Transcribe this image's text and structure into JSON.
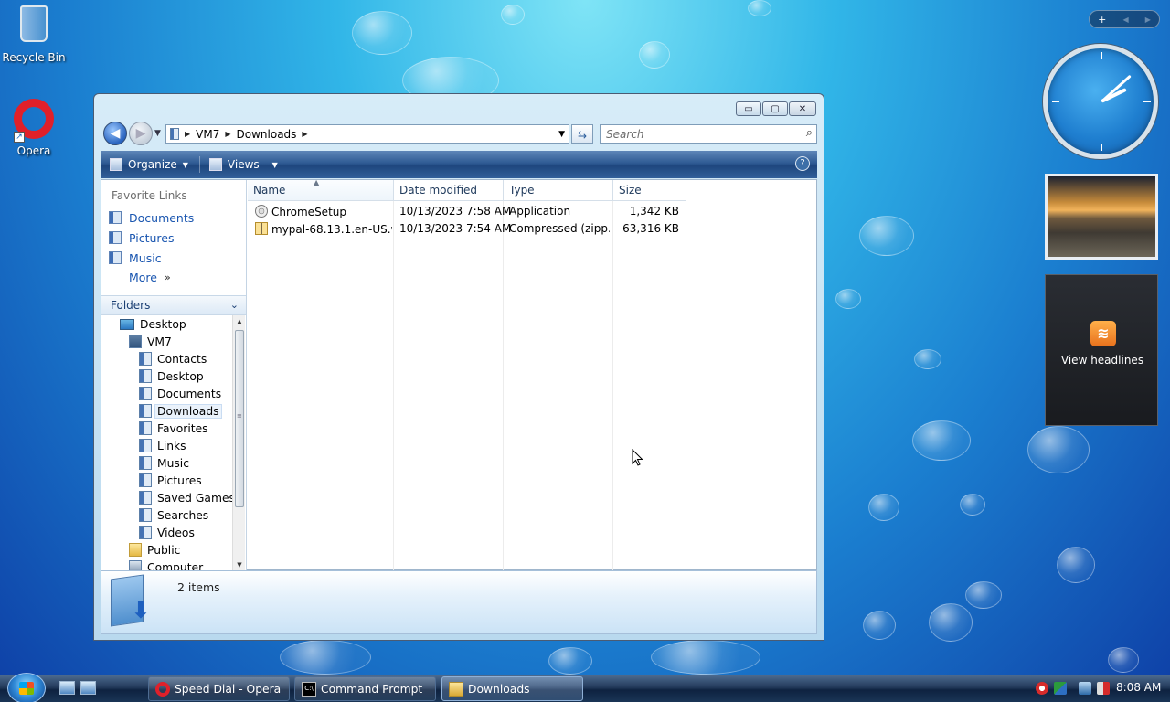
{
  "desktop": {
    "icons": [
      {
        "label": "Recycle Bin",
        "icon": "recycle-bin-icon"
      },
      {
        "label": "Opera",
        "icon": "opera-icon"
      }
    ]
  },
  "window": {
    "title_buttons": {
      "minimize": "▭",
      "maximize": "▢",
      "close": "✕"
    },
    "address": {
      "segments": [
        "VM7",
        "Downloads"
      ],
      "separator": "▶"
    },
    "search_placeholder": "Search",
    "toolbar": {
      "organize": "Organize",
      "views": "Views",
      "help": "?"
    },
    "favorites": {
      "title": "Favorite Links",
      "links": [
        "Documents",
        "Pictures",
        "Music"
      ],
      "more": "More",
      "more_chevron": "»"
    },
    "folders": {
      "header": "Folders",
      "items": [
        {
          "label": "Desktop",
          "icon": "desktop-icon"
        },
        {
          "label": "VM7",
          "icon": "user-folder-icon"
        },
        {
          "label": "Contacts",
          "icon": "contacts-folder-icon"
        },
        {
          "label": "Desktop",
          "icon": "desktop-folder-icon"
        },
        {
          "label": "Documents",
          "icon": "documents-folder-icon"
        },
        {
          "label": "Downloads",
          "icon": "downloads-folder-icon",
          "selected": true
        },
        {
          "label": "Favorites",
          "icon": "favorites-folder-icon"
        },
        {
          "label": "Links",
          "icon": "links-folder-icon"
        },
        {
          "label": "Music",
          "icon": "music-folder-icon"
        },
        {
          "label": "Pictures",
          "icon": "pictures-folder-icon"
        },
        {
          "label": "Saved Games",
          "icon": "saved-games-folder-icon"
        },
        {
          "label": "Searches",
          "icon": "searches-folder-icon"
        },
        {
          "label": "Videos",
          "icon": "videos-folder-icon"
        },
        {
          "label": "Public",
          "icon": "public-folder-icon"
        },
        {
          "label": "Computer",
          "icon": "computer-icon"
        }
      ]
    },
    "columns": {
      "name": "Name",
      "date": "Date modified",
      "type": "Type",
      "size": "Size"
    },
    "files": [
      {
        "name": "ChromeSetup",
        "date": "10/13/2023 7:58 AM",
        "type": "Application",
        "size": "1,342 KB",
        "icon": "application-icon"
      },
      {
        "name": "mypal-68.13.1.en-US.w...",
        "date": "10/13/2023 7:54 AM",
        "type": "Compressed (zipp...",
        "size": "63,316 KB",
        "icon": "zip-folder-icon"
      }
    ],
    "details": {
      "count": "2 items"
    }
  },
  "sidebar": {
    "controls": {
      "add": "+",
      "prev": "◀",
      "next": "▶"
    },
    "feed_label": "View headlines",
    "clock_time": "8:08"
  },
  "taskbar": {
    "tasks": [
      {
        "label": "Speed Dial - Opera",
        "icon": "opera-icon"
      },
      {
        "label": "Command Prompt",
        "icon": "command-prompt-icon"
      },
      {
        "label": "Downloads",
        "icon": "folder-icon",
        "active": true
      }
    ],
    "time": "8:08 AM"
  },
  "colors": {
    "accent": "#1a56b0",
    "toolbar": "#2e5a93",
    "taskbar": "#0e2240"
  }
}
